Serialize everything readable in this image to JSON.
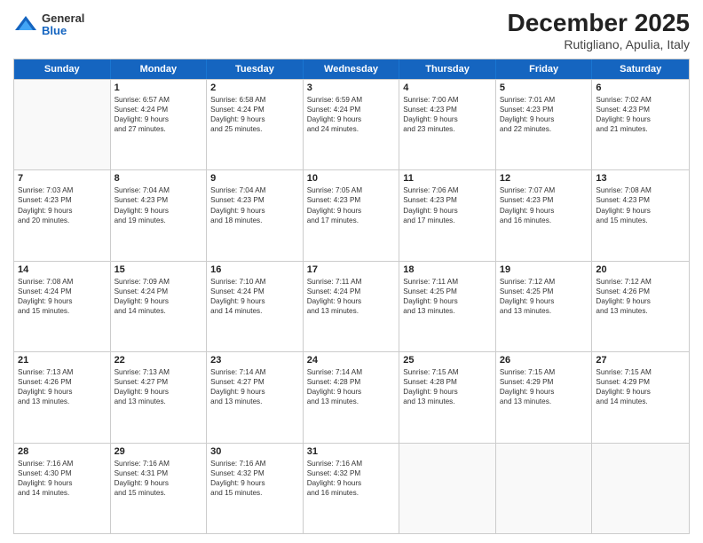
{
  "logo": {
    "general": "General",
    "blue": "Blue"
  },
  "title": "December 2025",
  "subtitle": "Rutigliano, Apulia, Italy",
  "header_days": [
    "Sunday",
    "Monday",
    "Tuesday",
    "Wednesday",
    "Thursday",
    "Friday",
    "Saturday"
  ],
  "weeks": [
    [
      {
        "day": "",
        "info": ""
      },
      {
        "day": "1",
        "info": "Sunrise: 6:57 AM\nSunset: 4:24 PM\nDaylight: 9 hours\nand 27 minutes."
      },
      {
        "day": "2",
        "info": "Sunrise: 6:58 AM\nSunset: 4:24 PM\nDaylight: 9 hours\nand 25 minutes."
      },
      {
        "day": "3",
        "info": "Sunrise: 6:59 AM\nSunset: 4:24 PM\nDaylight: 9 hours\nand 24 minutes."
      },
      {
        "day": "4",
        "info": "Sunrise: 7:00 AM\nSunset: 4:23 PM\nDaylight: 9 hours\nand 23 minutes."
      },
      {
        "day": "5",
        "info": "Sunrise: 7:01 AM\nSunset: 4:23 PM\nDaylight: 9 hours\nand 22 minutes."
      },
      {
        "day": "6",
        "info": "Sunrise: 7:02 AM\nSunset: 4:23 PM\nDaylight: 9 hours\nand 21 minutes."
      }
    ],
    [
      {
        "day": "7",
        "info": "Sunrise: 7:03 AM\nSunset: 4:23 PM\nDaylight: 9 hours\nand 20 minutes."
      },
      {
        "day": "8",
        "info": "Sunrise: 7:04 AM\nSunset: 4:23 PM\nDaylight: 9 hours\nand 19 minutes."
      },
      {
        "day": "9",
        "info": "Sunrise: 7:04 AM\nSunset: 4:23 PM\nDaylight: 9 hours\nand 18 minutes."
      },
      {
        "day": "10",
        "info": "Sunrise: 7:05 AM\nSunset: 4:23 PM\nDaylight: 9 hours\nand 17 minutes."
      },
      {
        "day": "11",
        "info": "Sunrise: 7:06 AM\nSunset: 4:23 PM\nDaylight: 9 hours\nand 17 minutes."
      },
      {
        "day": "12",
        "info": "Sunrise: 7:07 AM\nSunset: 4:23 PM\nDaylight: 9 hours\nand 16 minutes."
      },
      {
        "day": "13",
        "info": "Sunrise: 7:08 AM\nSunset: 4:23 PM\nDaylight: 9 hours\nand 15 minutes."
      }
    ],
    [
      {
        "day": "14",
        "info": "Sunrise: 7:08 AM\nSunset: 4:24 PM\nDaylight: 9 hours\nand 15 minutes."
      },
      {
        "day": "15",
        "info": "Sunrise: 7:09 AM\nSunset: 4:24 PM\nDaylight: 9 hours\nand 14 minutes."
      },
      {
        "day": "16",
        "info": "Sunrise: 7:10 AM\nSunset: 4:24 PM\nDaylight: 9 hours\nand 14 minutes."
      },
      {
        "day": "17",
        "info": "Sunrise: 7:11 AM\nSunset: 4:24 PM\nDaylight: 9 hours\nand 13 minutes."
      },
      {
        "day": "18",
        "info": "Sunrise: 7:11 AM\nSunset: 4:25 PM\nDaylight: 9 hours\nand 13 minutes."
      },
      {
        "day": "19",
        "info": "Sunrise: 7:12 AM\nSunset: 4:25 PM\nDaylight: 9 hours\nand 13 minutes."
      },
      {
        "day": "20",
        "info": "Sunrise: 7:12 AM\nSunset: 4:26 PM\nDaylight: 9 hours\nand 13 minutes."
      }
    ],
    [
      {
        "day": "21",
        "info": "Sunrise: 7:13 AM\nSunset: 4:26 PM\nDaylight: 9 hours\nand 13 minutes."
      },
      {
        "day": "22",
        "info": "Sunrise: 7:13 AM\nSunset: 4:27 PM\nDaylight: 9 hours\nand 13 minutes."
      },
      {
        "day": "23",
        "info": "Sunrise: 7:14 AM\nSunset: 4:27 PM\nDaylight: 9 hours\nand 13 minutes."
      },
      {
        "day": "24",
        "info": "Sunrise: 7:14 AM\nSunset: 4:28 PM\nDaylight: 9 hours\nand 13 minutes."
      },
      {
        "day": "25",
        "info": "Sunrise: 7:15 AM\nSunset: 4:28 PM\nDaylight: 9 hours\nand 13 minutes."
      },
      {
        "day": "26",
        "info": "Sunrise: 7:15 AM\nSunset: 4:29 PM\nDaylight: 9 hours\nand 13 minutes."
      },
      {
        "day": "27",
        "info": "Sunrise: 7:15 AM\nSunset: 4:29 PM\nDaylight: 9 hours\nand 14 minutes."
      }
    ],
    [
      {
        "day": "28",
        "info": "Sunrise: 7:16 AM\nSunset: 4:30 PM\nDaylight: 9 hours\nand 14 minutes."
      },
      {
        "day": "29",
        "info": "Sunrise: 7:16 AM\nSunset: 4:31 PM\nDaylight: 9 hours\nand 15 minutes."
      },
      {
        "day": "30",
        "info": "Sunrise: 7:16 AM\nSunset: 4:32 PM\nDaylight: 9 hours\nand 15 minutes."
      },
      {
        "day": "31",
        "info": "Sunrise: 7:16 AM\nSunset: 4:32 PM\nDaylight: 9 hours\nand 16 minutes."
      },
      {
        "day": "",
        "info": ""
      },
      {
        "day": "",
        "info": ""
      },
      {
        "day": "",
        "info": ""
      }
    ]
  ]
}
